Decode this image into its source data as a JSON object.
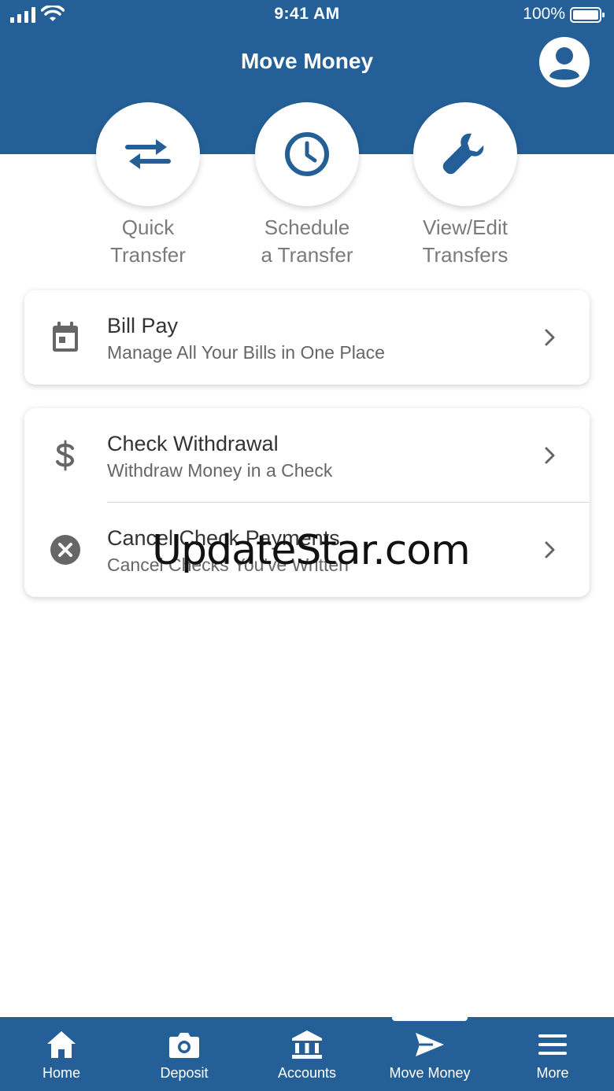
{
  "status_bar": {
    "time": "9:41 AM",
    "battery": "100%"
  },
  "header": {
    "title": "Move Money"
  },
  "actions": [
    {
      "line1": "Quick",
      "line2": "Transfer"
    },
    {
      "line1": "Schedule",
      "line2": "a Transfer"
    },
    {
      "line1": "View/Edit",
      "line2": "Transfers"
    }
  ],
  "bill_pay": {
    "title": "Bill Pay",
    "subtitle": "Manage All Your Bills in One Place"
  },
  "check_withdrawal": {
    "title": "Check Withdrawal",
    "subtitle": "Withdraw Money in a Check"
  },
  "cancel_check": {
    "title": "Cancel Check Payments",
    "subtitle": "Cancel Checks You've Written"
  },
  "watermark": "UpdateStar.com",
  "tabs": [
    {
      "label": "Home",
      "icon": "home-icon"
    },
    {
      "label": "Deposit",
      "icon": "camera-icon"
    },
    {
      "label": "Accounts",
      "icon": "bank-icon"
    },
    {
      "label": "Move Money",
      "icon": "send-icon",
      "active": true
    },
    {
      "label": "More",
      "icon": "menu-icon"
    }
  ],
  "colors": {
    "brand": "#246097",
    "icon_gray": "#666666"
  }
}
